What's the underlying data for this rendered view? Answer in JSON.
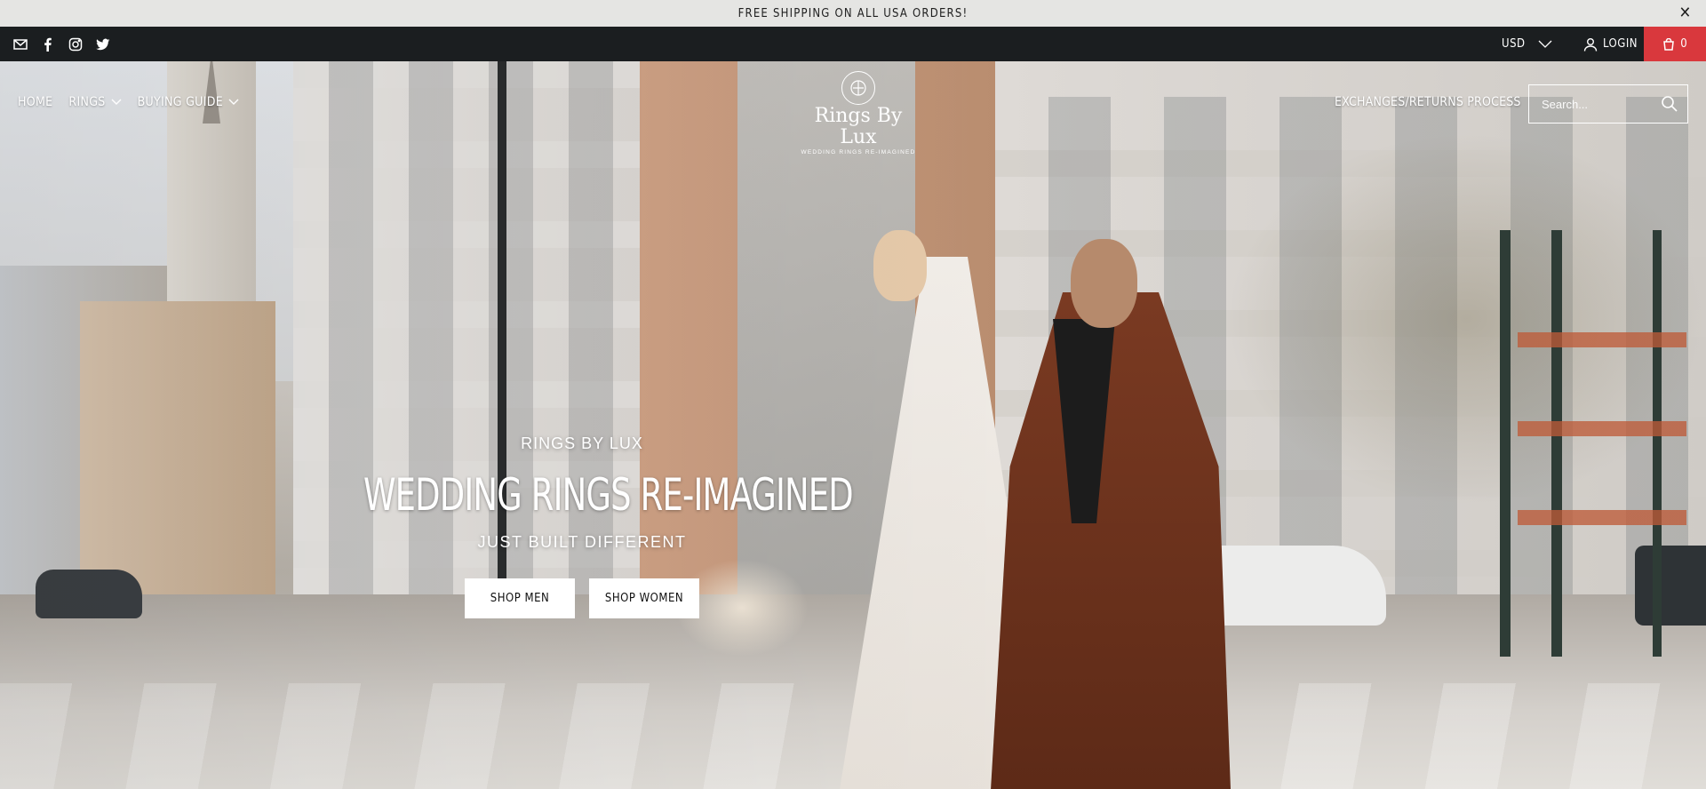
{
  "announcement": {
    "text": "FREE SHIPPING ON ALL USA ORDERS!",
    "close_glyph": "✕"
  },
  "topbar": {
    "social_icons": [
      "mail-icon",
      "facebook-icon",
      "instagram-icon",
      "twitter-icon"
    ],
    "currency": "USD",
    "login_label": "LOGIN",
    "cart_count": "0",
    "cart_color": "#d9383d",
    "bar_color": "#1b1e20"
  },
  "nav": {
    "items": [
      {
        "label": "HOME",
        "has_dropdown": false
      },
      {
        "label": "RINGS",
        "has_dropdown": true
      },
      {
        "label": "BUYING GUIDE",
        "has_dropdown": true
      }
    ],
    "right_link": "EXCHANGES/RETURNS PROCESS"
  },
  "logo": {
    "name": "Rings By Lux",
    "tagline": "WEDDING RINGS RE-IMAGINED"
  },
  "search": {
    "placeholder": "Search..."
  },
  "hero": {
    "kicker": "RINGS BY LUX",
    "headline": "WEDDING RINGS RE-IMAGINED",
    "subheadline": "JUST BUILT DIFFERENT",
    "buttons": [
      {
        "label": "SHOP MEN"
      },
      {
        "label": "SHOP WOMEN"
      }
    ]
  }
}
